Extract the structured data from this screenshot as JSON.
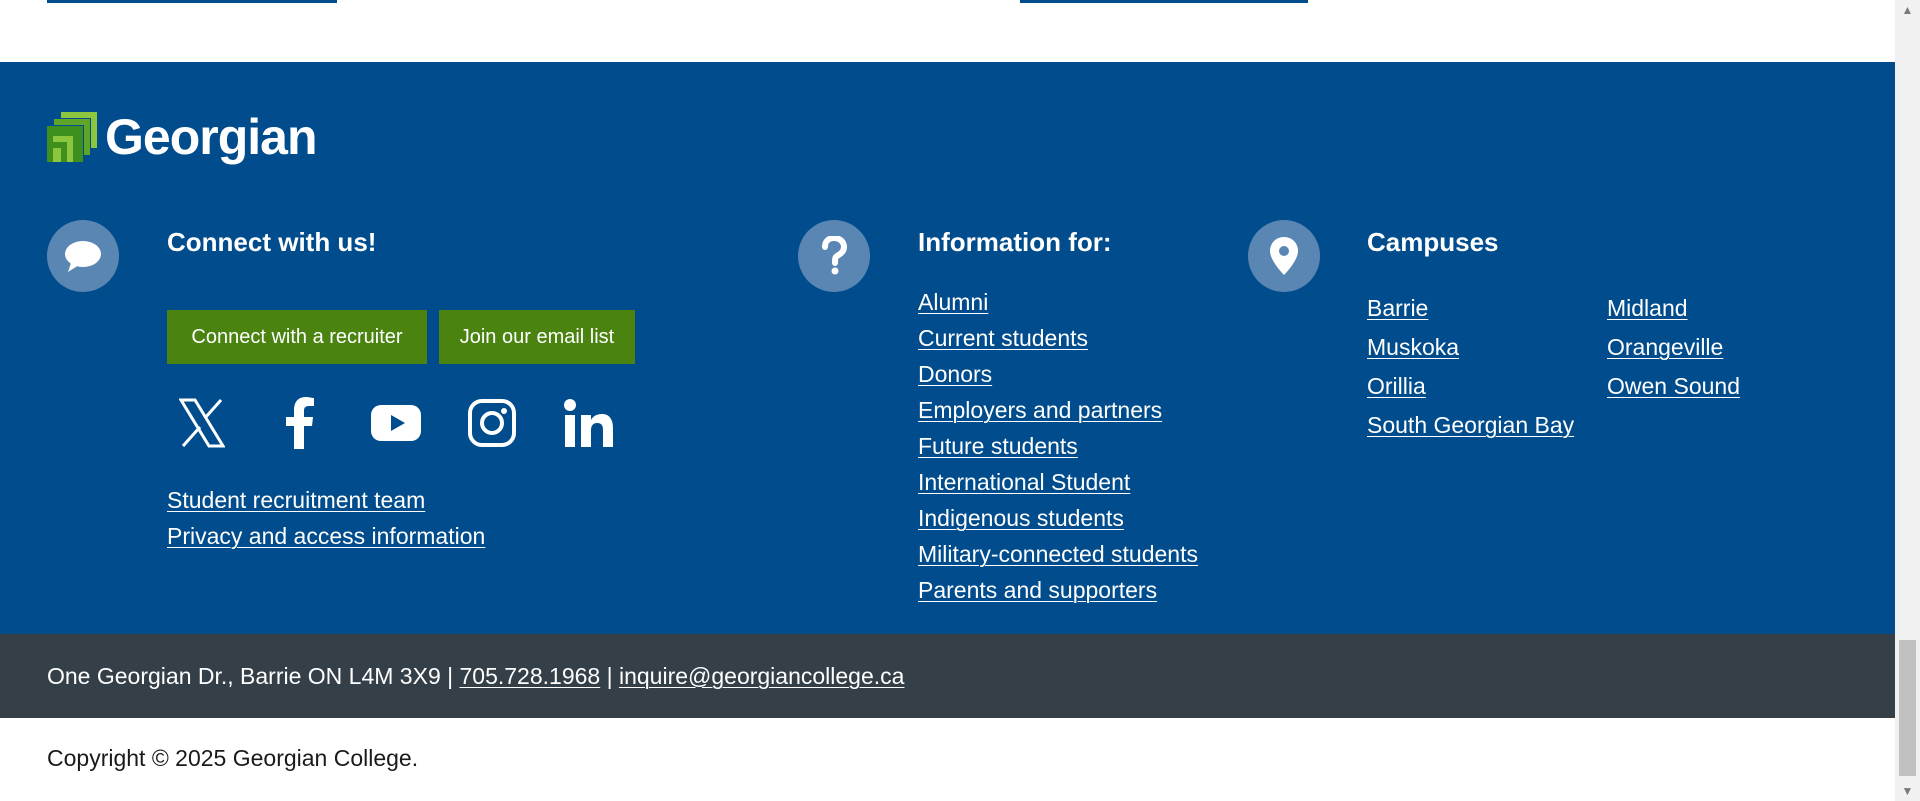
{
  "brand": {
    "name": "Georgian",
    "colors": {
      "primary_blue": "#004c8c",
      "accent_green": "#4b8311",
      "contact_bar": "#343f48",
      "icon_circle": "#5a86b4"
    }
  },
  "connect": {
    "title": "Connect with us!",
    "icon": "chat-bubble-icon",
    "recruiter_button": "Connect with a recruiter",
    "email_button": "Join our email list",
    "social": [
      {
        "name": "x",
        "icon": "x-icon"
      },
      {
        "name": "facebook",
        "icon": "facebook-icon"
      },
      {
        "name": "youtube",
        "icon": "youtube-icon"
      },
      {
        "name": "instagram",
        "icon": "instagram-icon"
      },
      {
        "name": "linkedin",
        "icon": "linkedin-icon"
      }
    ],
    "links": [
      "Student recruitment team",
      "Privacy and access information"
    ]
  },
  "information": {
    "title": "Information for:",
    "icon": "question-icon",
    "links": [
      "Alumni",
      "Current students",
      "Donors",
      "Employers and partners",
      "Future students",
      "International Student",
      "Indigenous students",
      "Military-connected students",
      "Parents and supporters"
    ]
  },
  "campuses": {
    "title": "Campuses",
    "icon": "map-pin-icon",
    "links": [
      "Barrie",
      "Midland",
      "Muskoka",
      "Orangeville",
      "Orillia",
      "Owen Sound",
      "South Georgian Bay"
    ]
  },
  "contact": {
    "address": "One Georgian Dr., Barrie ON L4M 3X9",
    "separator": "|",
    "phone": "705.728.1968",
    "email": "inquire@georgiancollege.ca"
  },
  "copyright": "Copyright © 2025 Georgian College."
}
